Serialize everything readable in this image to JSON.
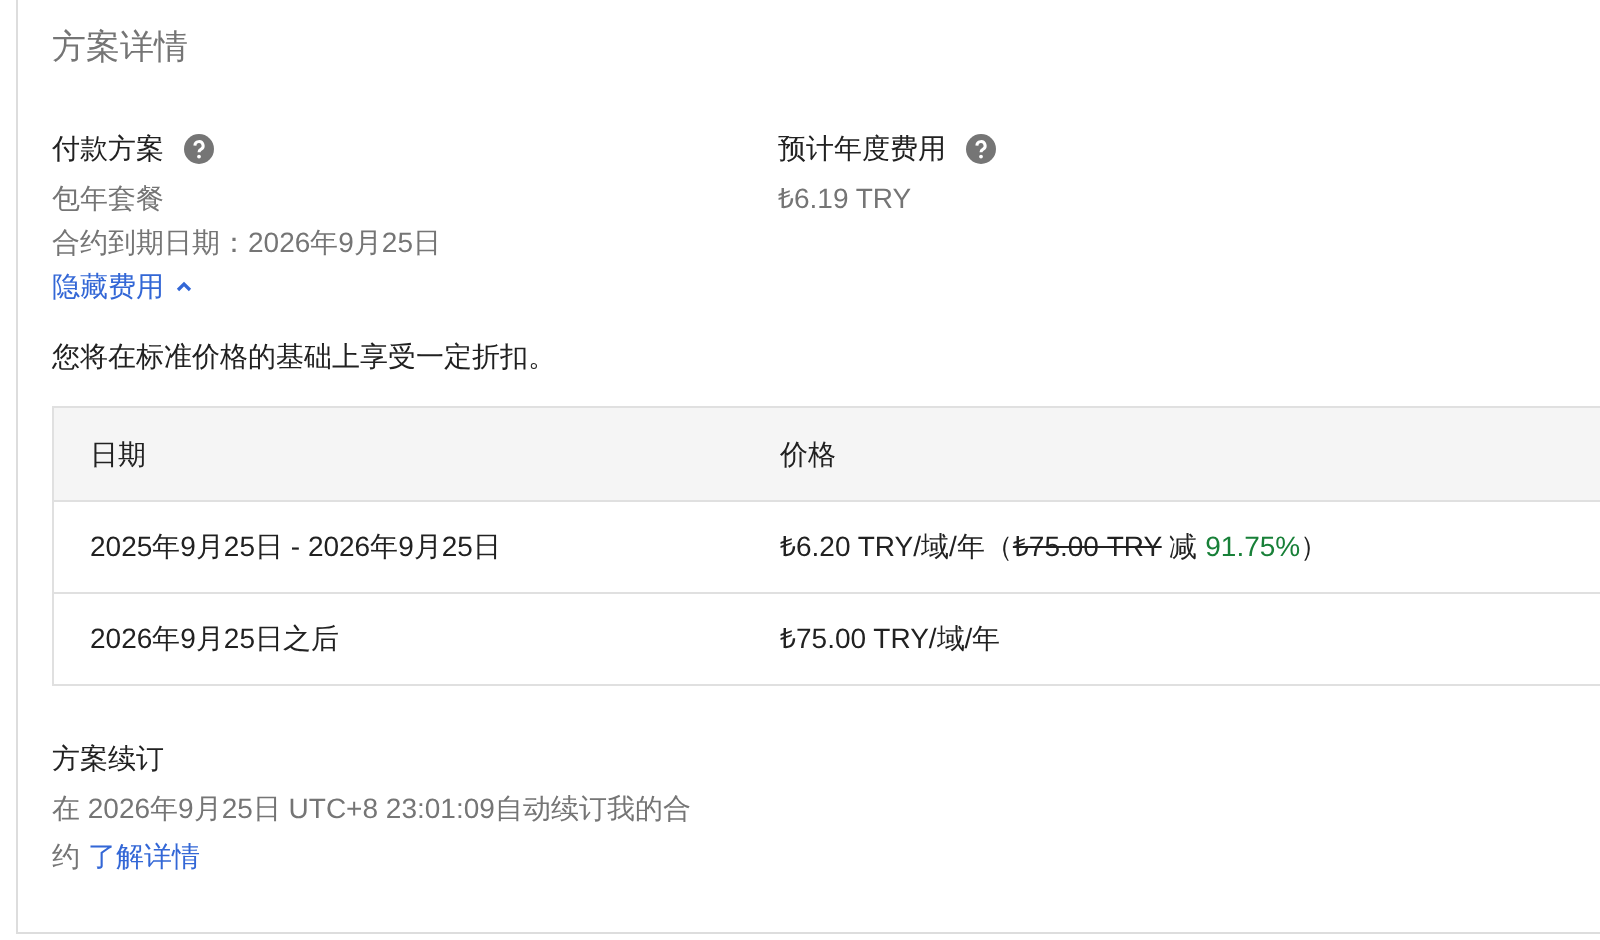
{
  "title": "方案详情",
  "payment": {
    "label": "付款方案",
    "plan": "包年套餐",
    "expiry": "合约到期日期：2026年9月25日",
    "toggle_link": "隐藏费用",
    "expanded": true
  },
  "annual_cost": {
    "label": "预计年度费用",
    "value": "₺6.19 TRY"
  },
  "discount_note": "您将在标准价格的基础上享受一定折扣。",
  "table": {
    "columns": [
      "日期",
      "价格"
    ],
    "rows": [
      {
        "date": "2025年9月25日 - 2026年9月25日",
        "price": "₺6.20 TRY/域/年（",
        "original_price": "₺75.00 TRY",
        "discount_label": " 减 ",
        "discount": "91.75%",
        "close": "）"
      },
      {
        "date": "2026年9月25日之后",
        "price": "₺75.00 TRY/域/年"
      }
    ]
  },
  "renewal": {
    "label": "方案续订",
    "text": "在 2026年9月25日 UTC+8 23:01:09自动续订我的合约",
    "link": "了解详情"
  }
}
